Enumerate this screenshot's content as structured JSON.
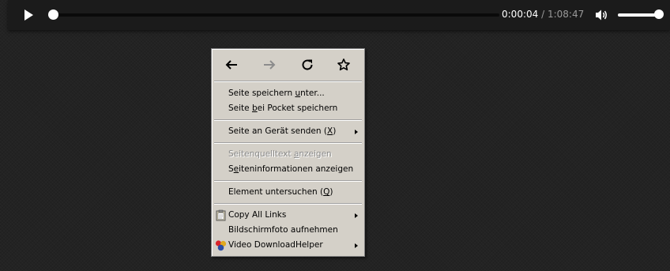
{
  "player": {
    "current_time": "0:00:04",
    "separator": "/",
    "duration": "1:08:47",
    "progress_fraction": 0.001,
    "volume_fraction": 1.0
  },
  "context_menu": {
    "nav": [
      {
        "icon": "back-arrow-icon",
        "enabled": true
      },
      {
        "icon": "forward-arrow-icon",
        "enabled": false
      },
      {
        "icon": "reload-icon",
        "enabled": true
      },
      {
        "icon": "bookmark-star-icon",
        "enabled": true
      }
    ],
    "items": {
      "save_page": {
        "pre": "Seite speichern ",
        "key": "u",
        "post": "nter..."
      },
      "pocket": {
        "pre": "Seite ",
        "key": "b",
        "post": "ei Pocket speichern"
      },
      "send_to_device": {
        "pre": "Seite an Gerät senden (",
        "key": "X",
        "post": ")"
      },
      "view_source": {
        "pre": "Seitenquelltext ",
        "key": "a",
        "post": "nzeigen"
      },
      "page_info": {
        "pre": "S",
        "key": "e",
        "post": "iteninformationen anzeigen"
      },
      "inspect": {
        "pre": "Element untersuchen (",
        "key": "Q",
        "post": ")"
      },
      "copy_all_links": "Copy All Links",
      "screenshot": "Bildschirmfoto aufnehmen",
      "video_downloadhelper": "Video DownloadHelper"
    }
  }
}
